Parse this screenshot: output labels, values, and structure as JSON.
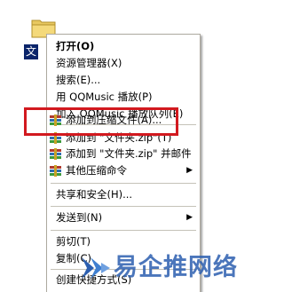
{
  "desktop": {
    "folder_label": "文"
  },
  "menu": {
    "items": [
      {
        "label": "打开(O)",
        "bold": true
      },
      {
        "label": "资源管理器(X)"
      },
      {
        "label": "搜索(E)..."
      },
      {
        "label": "用 QQMusic 播放(P)"
      },
      {
        "label": "加入 QQMusic 播放队列(E)"
      },
      {
        "label": "添加到压缩文件(A)...",
        "icon": "winrar-icon"
      },
      {
        "label": "添加到 \"文件夹.zip\"(T)",
        "icon": "winrar-icon"
      },
      {
        "label": "添加到 \"文件夹.zip\" 并邮件",
        "icon": "winrar-icon"
      },
      {
        "label": "其他压缩命令",
        "icon": "winrar-icon",
        "submenu": true
      },
      {
        "label": "共享和安全(H)..."
      },
      {
        "label": "发送到(N)",
        "submenu": true
      },
      {
        "label": "剪切(T)"
      },
      {
        "label": "复制(C)"
      },
      {
        "label": "创建快捷方式(S)"
      }
    ],
    "submenu_arrow": "▶"
  },
  "watermark": {
    "text": "易企推网络"
  },
  "colors": {
    "highlight_box": "#d2191f",
    "watermark": "#2c5fb0"
  }
}
